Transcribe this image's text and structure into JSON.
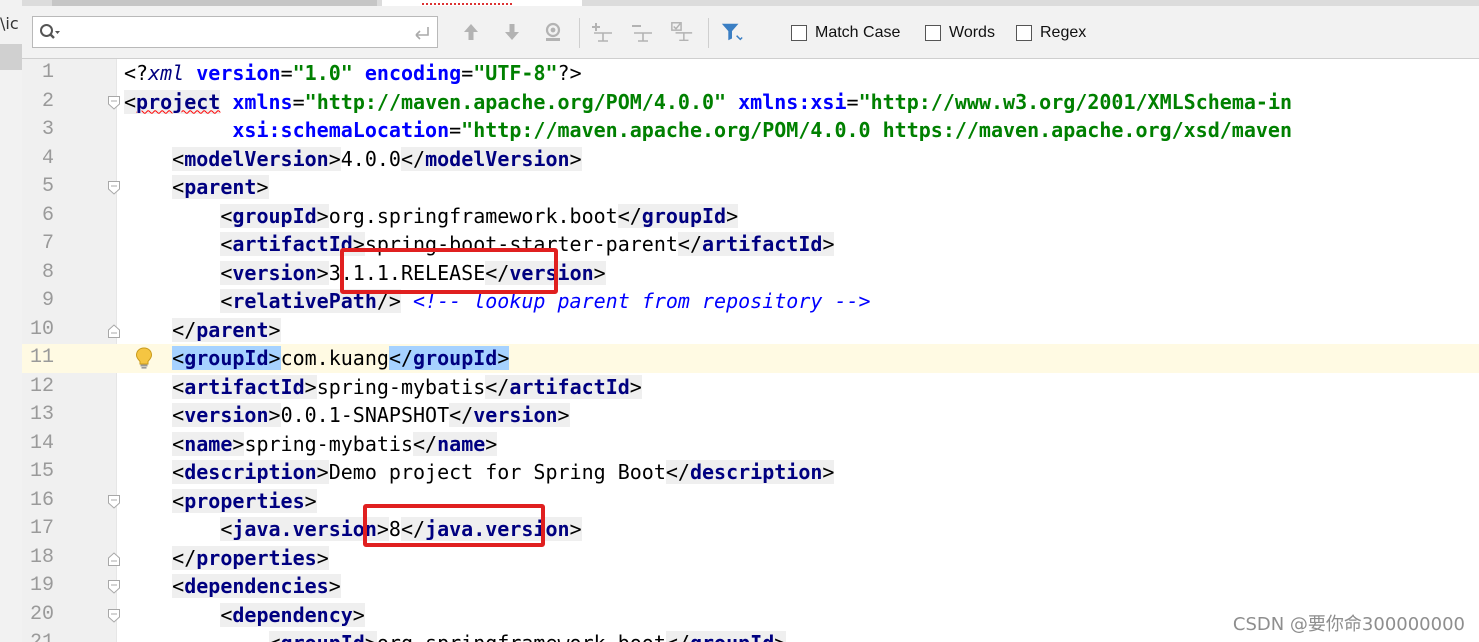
{
  "left_strip": {
    "fragment": "\\ic"
  },
  "find_bar": {
    "search_value": "",
    "options": [
      {
        "label": "Match Case",
        "checked": false
      },
      {
        "label": "Words",
        "checked": false
      },
      {
        "label": "Regex",
        "checked": false
      }
    ],
    "icons": [
      "search-icon",
      "enter-icon",
      "previous-occurrence-icon",
      "next-occurrence-icon",
      "find-usages-icon",
      "add-occurrence-icon",
      "remove-occurrence-icon",
      "select-all-occurrences-icon",
      "filter-icon"
    ]
  },
  "editor": {
    "lines": [
      {
        "n": "1",
        "tokens": [
          [
            "pi",
            "<?"
          ],
          [
            "pin",
            "xml"
          ],
          [
            "txt",
            " "
          ],
          [
            "att",
            "version"
          ],
          [
            "txt",
            "="
          ],
          [
            "val",
            "\"1.0\""
          ],
          [
            "txt",
            " "
          ],
          [
            "att",
            "encoding"
          ],
          [
            "txt",
            "="
          ],
          [
            "val",
            "\"UTF-8\""
          ],
          [
            "pi",
            "?>"
          ]
        ]
      },
      {
        "n": "2",
        "fold": "open",
        "tokens": [
          [
            "pun",
            "<"
          ],
          [
            "tag squig",
            "project"
          ],
          [
            "txt",
            " "
          ],
          [
            "att",
            "xmlns"
          ],
          [
            "txt",
            "="
          ],
          [
            "val",
            "\"http://maven.apache.org/POM/4.0.0\""
          ],
          [
            "txt",
            " "
          ],
          [
            "att",
            "xmlns:xsi"
          ],
          [
            "txt",
            "="
          ],
          [
            "val",
            "\"http://www.w3.org/2001/XMLSchema-in"
          ]
        ]
      },
      {
        "n": "3",
        "tokens": [
          [
            "txt",
            "         "
          ],
          [
            "att",
            "xsi:schemaLocation"
          ],
          [
            "txt",
            "="
          ],
          [
            "val",
            "\"http://maven.apache.org/POM/4.0.0 https://maven.apache.org/xsd/maven"
          ]
        ]
      },
      {
        "n": "4",
        "tokens": [
          [
            "txt",
            "    "
          ],
          [
            "pun",
            "<"
          ],
          [
            "tag",
            "modelVersion"
          ],
          [
            "pun",
            ">"
          ],
          [
            "txt",
            "4.0.0"
          ],
          [
            "pun",
            "</"
          ],
          [
            "tag",
            "modelVersion"
          ],
          [
            "pun",
            ">"
          ]
        ]
      },
      {
        "n": "5",
        "fold": "open",
        "tokens": [
          [
            "txt",
            "    "
          ],
          [
            "pun",
            "<"
          ],
          [
            "tag",
            "parent"
          ],
          [
            "pun",
            ">"
          ]
        ]
      },
      {
        "n": "6",
        "tokens": [
          [
            "txt",
            "        "
          ],
          [
            "pun",
            "<"
          ],
          [
            "tag",
            "groupId"
          ],
          [
            "pun",
            ">"
          ],
          [
            "txt",
            "org.springframework.boot"
          ],
          [
            "pun",
            "</"
          ],
          [
            "tag",
            "groupId"
          ],
          [
            "pun",
            ">"
          ]
        ]
      },
      {
        "n": "7",
        "tokens": [
          [
            "txt",
            "        "
          ],
          [
            "pun",
            "<"
          ],
          [
            "tag",
            "artifactId"
          ],
          [
            "pun",
            ">"
          ],
          [
            "txt",
            "spring-boot-starter-parent"
          ],
          [
            "pun",
            "</"
          ],
          [
            "tag",
            "artifactId"
          ],
          [
            "pun",
            ">"
          ]
        ]
      },
      {
        "n": "8",
        "tokens": [
          [
            "txt",
            "        "
          ],
          [
            "pun",
            "<"
          ],
          [
            "tag",
            "version"
          ],
          [
            "pun",
            ">"
          ],
          [
            "txt",
            "3.1.1.RELEASE"
          ],
          [
            "pun",
            "</"
          ],
          [
            "tag",
            "version"
          ],
          [
            "pun",
            ">"
          ]
        ]
      },
      {
        "n": "9",
        "tokens": [
          [
            "txt",
            "        "
          ],
          [
            "pun",
            "<"
          ],
          [
            "tag",
            "relativePath"
          ],
          [
            "pun",
            "/>"
          ],
          [
            "txt",
            " "
          ],
          [
            "cmt",
            "<!-- lookup parent from repository -->"
          ]
        ]
      },
      {
        "n": "10",
        "fold": "close",
        "tokens": [
          [
            "txt",
            "    "
          ],
          [
            "pun",
            "</"
          ],
          [
            "tag",
            "parent"
          ],
          [
            "pun",
            ">"
          ]
        ]
      },
      {
        "n": "11",
        "caret": true,
        "bulb": true,
        "tokens": [
          [
            "txt",
            "    "
          ],
          [
            "pun hl",
            "<"
          ],
          [
            "tag hl",
            "groupId"
          ],
          [
            "pun hl",
            ">"
          ],
          [
            "txt",
            "com.kuang"
          ],
          [
            "pun hl",
            "</"
          ],
          [
            "tag hl",
            "groupId"
          ],
          [
            "pun hl",
            ">"
          ],
          [
            "cursor",
            ""
          ]
        ]
      },
      {
        "n": "12",
        "tokens": [
          [
            "txt",
            "    "
          ],
          [
            "pun",
            "<"
          ],
          [
            "tag",
            "artifactId"
          ],
          [
            "pun",
            ">"
          ],
          [
            "txt",
            "spring-mybatis"
          ],
          [
            "pun",
            "</"
          ],
          [
            "tag",
            "artifactId"
          ],
          [
            "pun",
            ">"
          ]
        ]
      },
      {
        "n": "13",
        "tokens": [
          [
            "txt",
            "    "
          ],
          [
            "pun",
            "<"
          ],
          [
            "tag",
            "version"
          ],
          [
            "pun",
            ">"
          ],
          [
            "txt",
            "0.0.1-SNAPSHOT"
          ],
          [
            "pun",
            "</"
          ],
          [
            "tag",
            "version"
          ],
          [
            "pun",
            ">"
          ]
        ]
      },
      {
        "n": "14",
        "tokens": [
          [
            "txt",
            "    "
          ],
          [
            "pun",
            "<"
          ],
          [
            "tag",
            "name"
          ],
          [
            "pun",
            ">"
          ],
          [
            "txt",
            "spring-mybatis"
          ],
          [
            "pun",
            "</"
          ],
          [
            "tag",
            "name"
          ],
          [
            "pun",
            ">"
          ]
        ]
      },
      {
        "n": "15",
        "tokens": [
          [
            "txt",
            "    "
          ],
          [
            "pun",
            "<"
          ],
          [
            "tag",
            "description"
          ],
          [
            "pun",
            ">"
          ],
          [
            "txt",
            "Demo project for Spring Boot"
          ],
          [
            "pun",
            "</"
          ],
          [
            "tag",
            "description"
          ],
          [
            "pun",
            ">"
          ]
        ]
      },
      {
        "n": "16",
        "fold": "open",
        "tokens": [
          [
            "txt",
            "    "
          ],
          [
            "pun",
            "<"
          ],
          [
            "tag",
            "properties"
          ],
          [
            "pun",
            ">"
          ]
        ]
      },
      {
        "n": "17",
        "tokens": [
          [
            "txt",
            "        "
          ],
          [
            "pun",
            "<"
          ],
          [
            "tag",
            "java.version"
          ],
          [
            "pun",
            ">"
          ],
          [
            "txt",
            "8"
          ],
          [
            "pun",
            "</"
          ],
          [
            "tag",
            "java.version"
          ],
          [
            "pun",
            ">"
          ]
        ]
      },
      {
        "n": "18",
        "fold": "close",
        "tokens": [
          [
            "txt",
            "    "
          ],
          [
            "pun",
            "</"
          ],
          [
            "tag",
            "properties"
          ],
          [
            "pun",
            ">"
          ]
        ]
      },
      {
        "n": "19",
        "fold": "open",
        "tokens": [
          [
            "txt",
            "    "
          ],
          [
            "pun",
            "<"
          ],
          [
            "tag",
            "dependencies"
          ],
          [
            "pun",
            ">"
          ]
        ]
      },
      {
        "n": "20",
        "fold": "open",
        "tokens": [
          [
            "txt",
            "        "
          ],
          [
            "pun",
            "<"
          ],
          [
            "tag",
            "dependency"
          ],
          [
            "pun",
            ">"
          ]
        ]
      },
      {
        "n": "21",
        "tokens": [
          [
            "txt",
            "            "
          ],
          [
            "pun",
            "<"
          ],
          [
            "tag",
            "groupId"
          ],
          [
            "pun",
            ">"
          ],
          [
            "txt",
            "org.springframework.boot"
          ],
          [
            "pun",
            "</"
          ],
          [
            "tag",
            "groupId"
          ],
          [
            "pun",
            ">"
          ]
        ]
      }
    ]
  },
  "annotations": {
    "highlight_color": "#e02020"
  },
  "watermark": "CSDN @要你命300000000"
}
